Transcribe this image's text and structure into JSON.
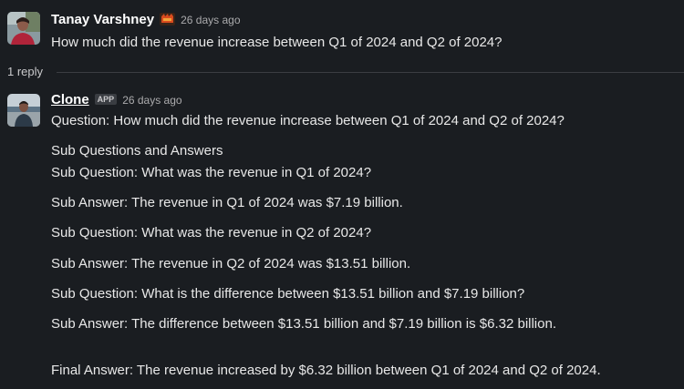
{
  "thread": {
    "parent": {
      "author": "Tanay Varshney",
      "timestamp": "26 days ago",
      "text": "How much did the revenue increase between Q1 of 2024 and Q2 of 2024?"
    },
    "reply_count": "1 reply"
  },
  "reply": {
    "author": "Clone",
    "app_badge": "APP",
    "timestamp": "26 days ago",
    "lines": {
      "question": "Question: How much did the revenue increase between Q1 of 2024 and Q2 of 2024?",
      "sub_header": "Sub Questions and Answers",
      "sq1": "Sub Question: What was the revenue in Q1 of 2024?",
      "sa1": "Sub Answer: The revenue in Q1 of 2024 was $7.19 billion.",
      "sq2": "Sub Question: What was the revenue in Q2 of 2024?",
      "sa2": "Sub Answer: The revenue in Q2 of 2024 was $13.51 billion.",
      "sq3": "Sub Question: What is the difference between $13.51 billion and $7.19 billion?",
      "sa3": "Sub Answer: The difference between $13.51 billion and $7.19 billion is $6.32 billion.",
      "final": "Final Answer: The revenue increased by $6.32 billion between Q1 of 2024 and Q2 of 2024."
    }
  },
  "icons": {
    "parent_avatar": "user-photo-avatar",
    "status_emoji": "custom-status-emoji",
    "bot_avatar": "bot-photo-avatar"
  },
  "colors": {
    "background": "#1a1d21",
    "text": "#e8e8e8",
    "muted": "#ababad",
    "author": "#ffffff"
  }
}
